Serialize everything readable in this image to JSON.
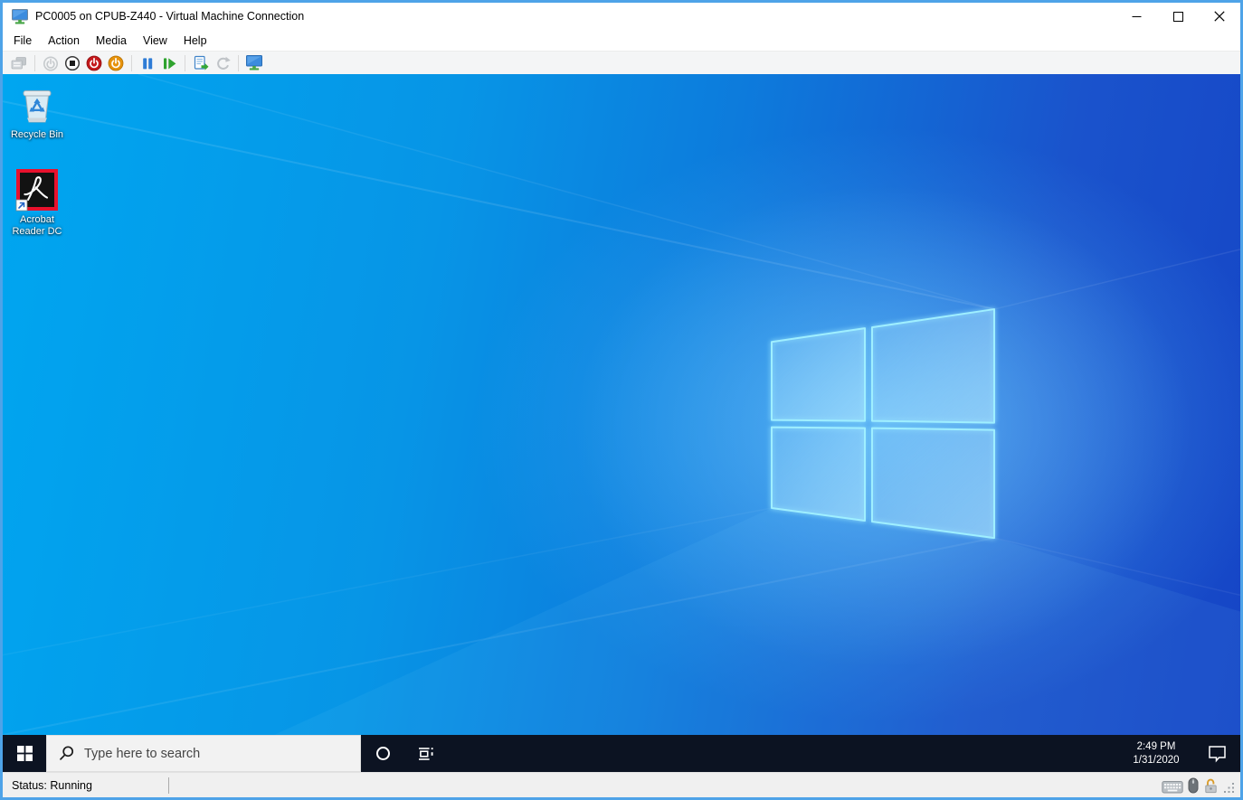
{
  "window": {
    "title": "PC0005 on CPUB-Z440 - Virtual Machine Connection",
    "icon": "virtual-machine-icon",
    "controls": [
      {
        "name": "minimize"
      },
      {
        "name": "maximize"
      },
      {
        "name": "close"
      }
    ]
  },
  "menu": {
    "items": [
      {
        "label": "File"
      },
      {
        "label": "Action"
      },
      {
        "label": "Media"
      },
      {
        "label": "View"
      },
      {
        "label": "Help"
      }
    ]
  },
  "toolbar": {
    "buttons": [
      {
        "icon": "ctrl-alt-delete-icon",
        "enabled": false
      },
      {
        "icon": "start-icon",
        "enabled": false
      },
      {
        "icon": "turn-off-icon",
        "enabled": true
      },
      {
        "icon": "shut-down-icon",
        "enabled": true
      },
      {
        "icon": "save-icon",
        "enabled": true
      },
      {
        "icon": "pause-icon",
        "enabled": true
      },
      {
        "icon": "reset-icon",
        "enabled": true
      },
      {
        "icon": "checkpoint-icon",
        "enabled": true
      },
      {
        "icon": "revert-icon",
        "enabled": false
      },
      {
        "icon": "enhanced-session-icon",
        "enabled": true
      }
    ]
  },
  "desktop": {
    "icons": [
      {
        "label": "Recycle Bin",
        "icon": "recycle-bin-icon"
      },
      {
        "label": "Acrobat Reader DC",
        "icon": "acrobat-reader-icon"
      }
    ]
  },
  "taskbar": {
    "search": {
      "placeholder": "Type here to search",
      "value": ""
    },
    "icons": [
      "start-icon",
      "search-icon",
      "cortana-icon",
      "task-view-icon",
      "action-center-icon"
    ],
    "clock": {
      "time": "2:49 PM",
      "date": "1/31/2020"
    }
  },
  "status_bar": {
    "text": "Status: Running",
    "icons": [
      "keyboard-indicator-icon",
      "mouse-indicator-icon",
      "lock-indicator-icon",
      "resize-grip"
    ]
  },
  "colors": {
    "window_border": "#4EA3E8",
    "taskbar_bg": "#0C1322",
    "desktop_gradient_left": "#00A6F0",
    "desktop_gradient_right": "#1545C6",
    "shutdown_red": "#C3191C",
    "save_orange": "#E6920B",
    "pause_blue": "#2E7CD6",
    "reset_green": "#2FA32F",
    "acrobat_red": "#E8112D"
  }
}
